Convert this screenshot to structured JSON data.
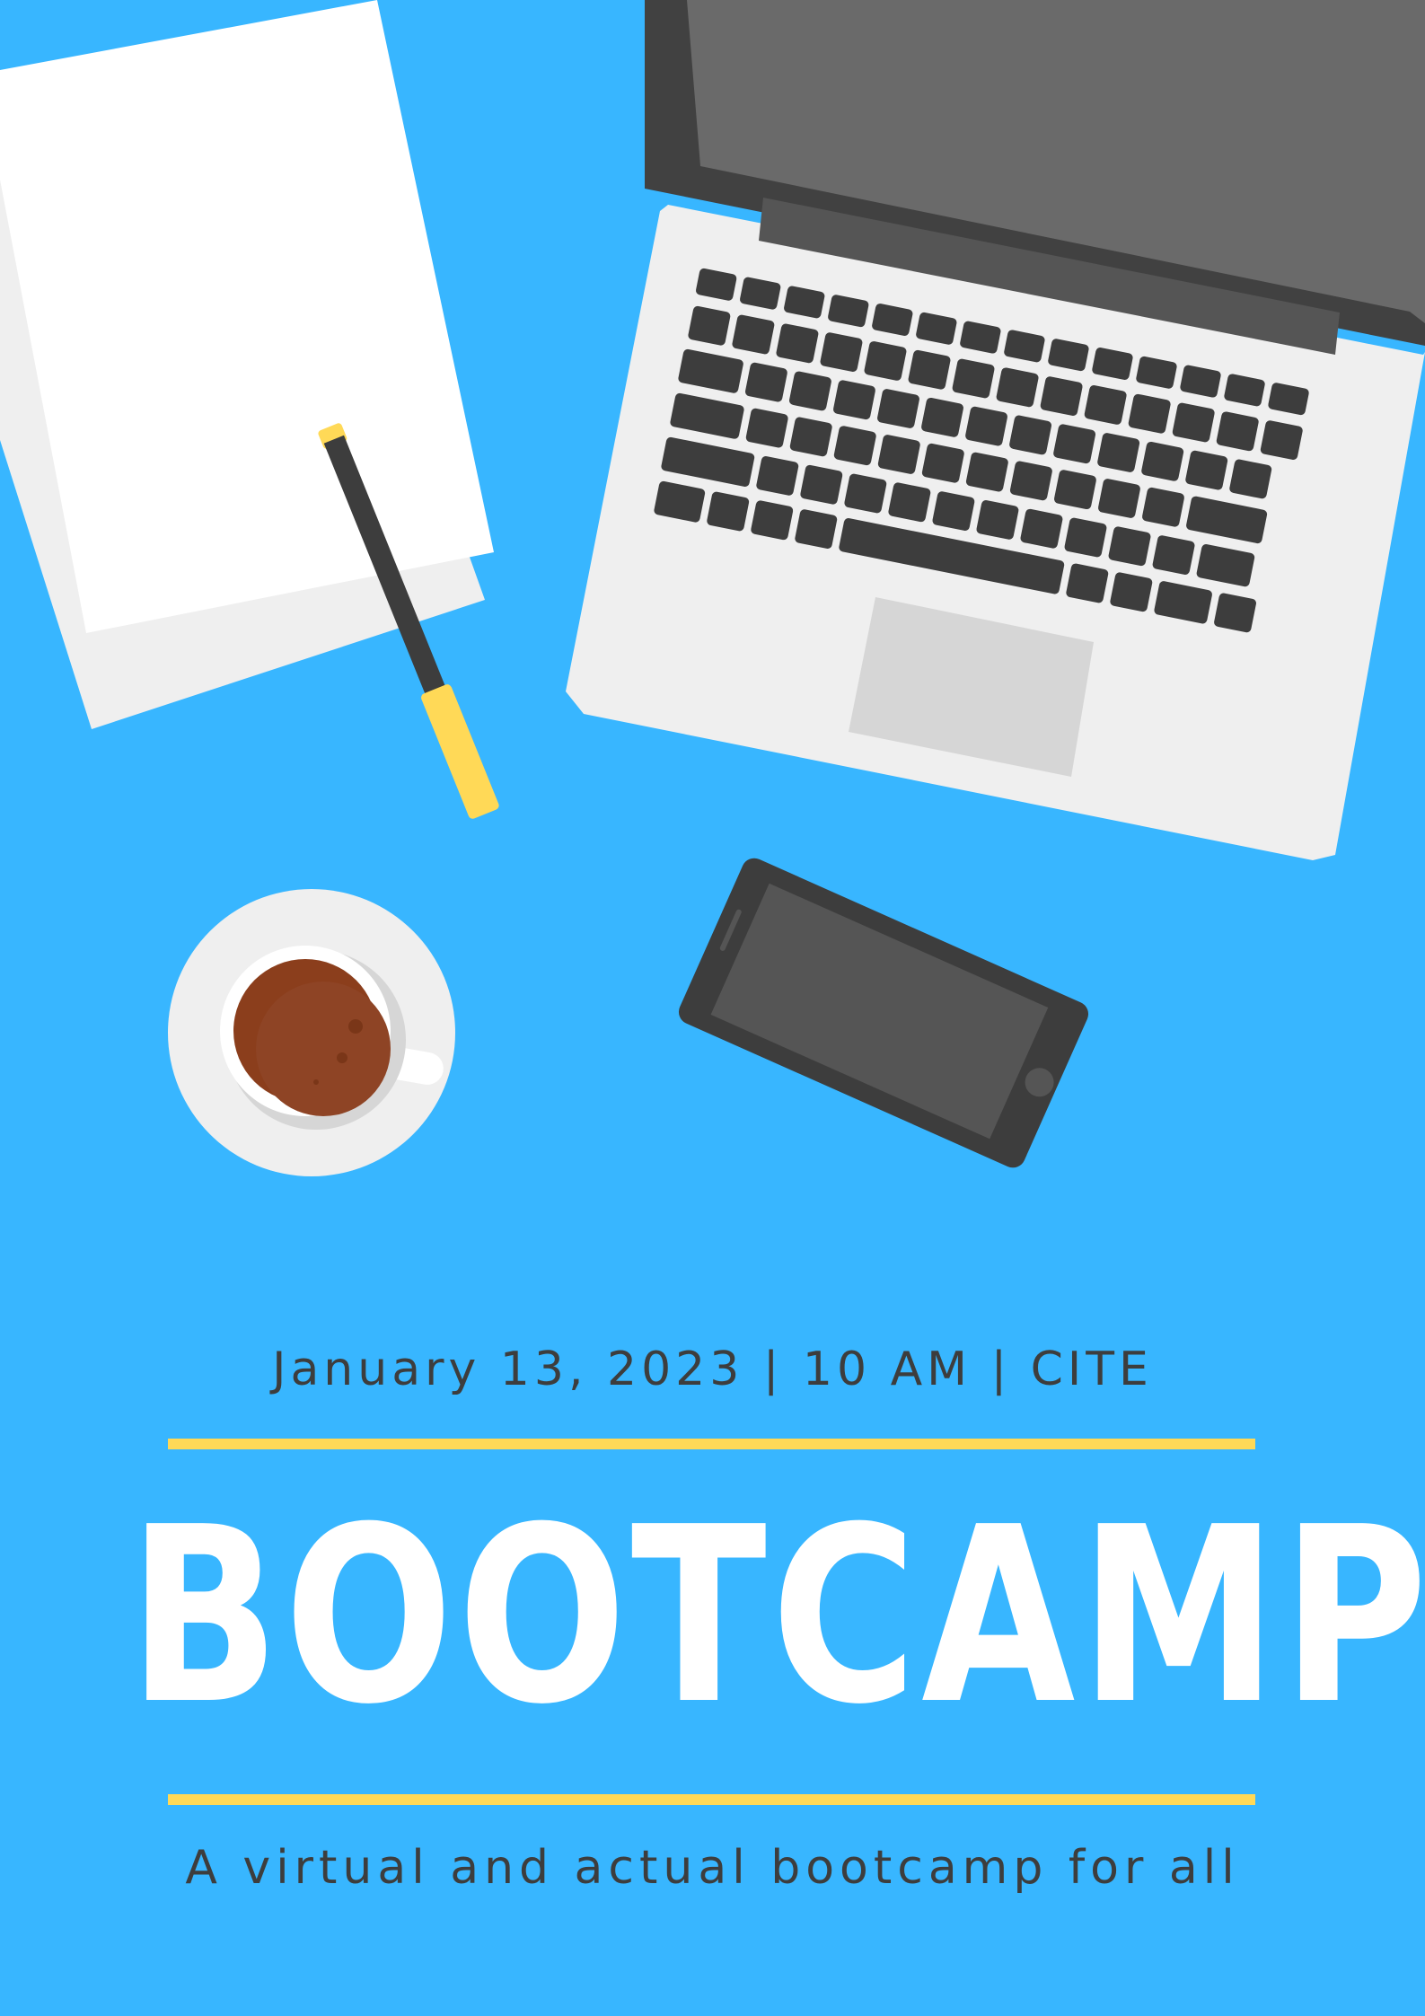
{
  "poster": {
    "event_info": "January 13, 2023 | 10 AM | CITE",
    "title": "BOOTCAMP",
    "tagline": "A virtual and actual bootcamp for all"
  },
  "colors": {
    "background": "#38b6ff",
    "accent_rule": "#ffd957",
    "title_text": "#ffffff",
    "body_text": "#3d3d3d"
  },
  "illustration": {
    "objects": [
      "paper-stack-icon",
      "pen-icon",
      "laptop-icon",
      "coffee-cup-icon",
      "smartphone-icon"
    ]
  }
}
